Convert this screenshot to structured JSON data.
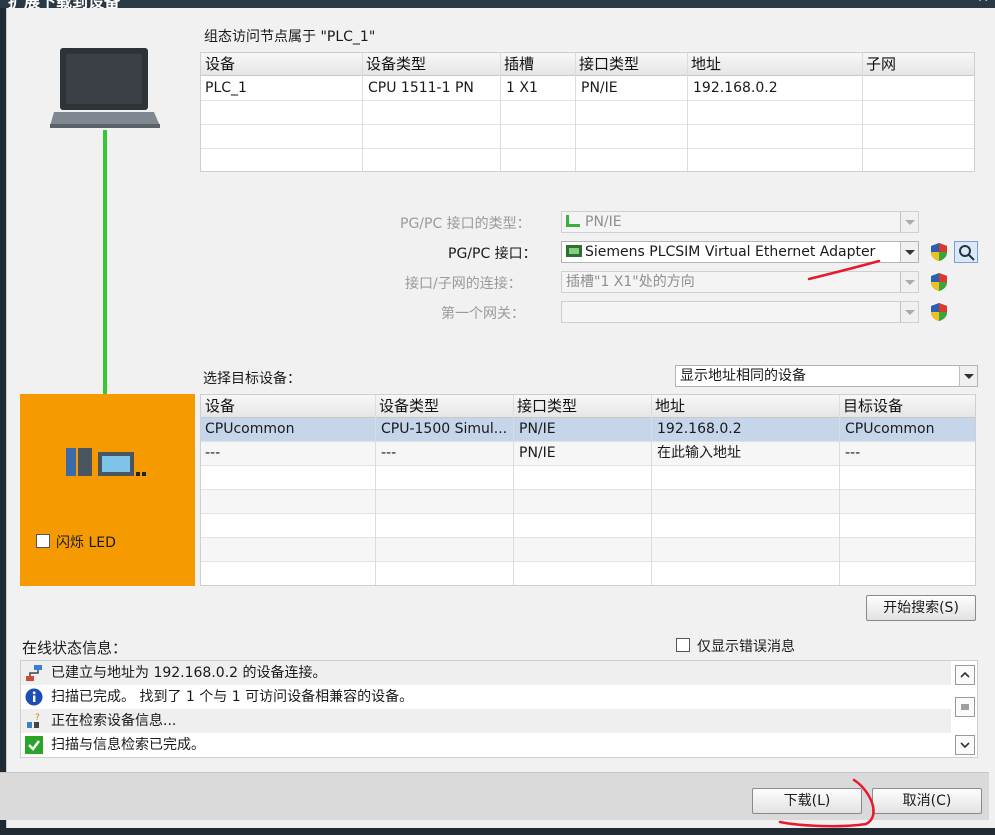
{
  "window": {
    "title": "扩展下载到设备",
    "close": "✕"
  },
  "top_table": {
    "caption": "组态访问节点属于 \"PLC_1\"",
    "columns": [
      "设备",
      "设备类型",
      "插槽",
      "接口类型",
      "地址",
      "子网"
    ],
    "rows": [
      [
        "PLC_1",
        "CPU 1511-1 PN",
        "1 X1",
        "PN/IE",
        "192.168.0.2",
        ""
      ]
    ]
  },
  "settings": {
    "pgpc_type_label": "PG/PC 接口的类型：",
    "pgpc_type_value": "PN/IE",
    "pgpc_iface_label": "PG/PC 接口：",
    "pgpc_iface_value": "Siemens PLCSIM Virtual Ethernet Adapter",
    "subnet_conn_label": "接口/子网的连接：",
    "subnet_conn_value": "插槽\"1 X1\"处的方向",
    "gateway_label": "第一个网关：",
    "gateway_value": ""
  },
  "target": {
    "caption": "选择目标设备：",
    "filter_value": "显示地址相同的设备",
    "columns": [
      "设备",
      "设备类型",
      "接口类型",
      "地址",
      "目标设备"
    ],
    "rows": [
      [
        "CPUcommon",
        "CPU-1500 Simul...",
        "PN/IE",
        "192.168.0.2",
        "CPUcommon"
      ],
      [
        "---",
        "---",
        "PN/IE",
        "在此输入地址",
        "---"
      ]
    ]
  },
  "flash_led_label": "闪烁 LED",
  "start_search_button": "开始搜索(S)",
  "status": {
    "caption": "在线状态信息：",
    "errors_only_label": "仅显示错误消息",
    "messages": [
      {
        "icon": "network-connection-icon",
        "text": "已建立与地址为 192.168.0.2 的设备连接。"
      },
      {
        "icon": "info-icon",
        "text": "扫描已完成。 找到了 1 个与 1 可访问设备相兼容的设备。"
      },
      {
        "icon": "retrieving-icon",
        "text": "正在检索设备信息..."
      },
      {
        "icon": "check-icon",
        "text": "扫描与信息检索已完成。"
      }
    ]
  },
  "buttons": {
    "download": "下载(L)",
    "cancel": "取消(C)"
  },
  "colors": {
    "accent_orange": "#f59a00",
    "link_green": "#35c735",
    "selected_row": "#c5d5ea",
    "annotation_red": "#e8192c"
  }
}
